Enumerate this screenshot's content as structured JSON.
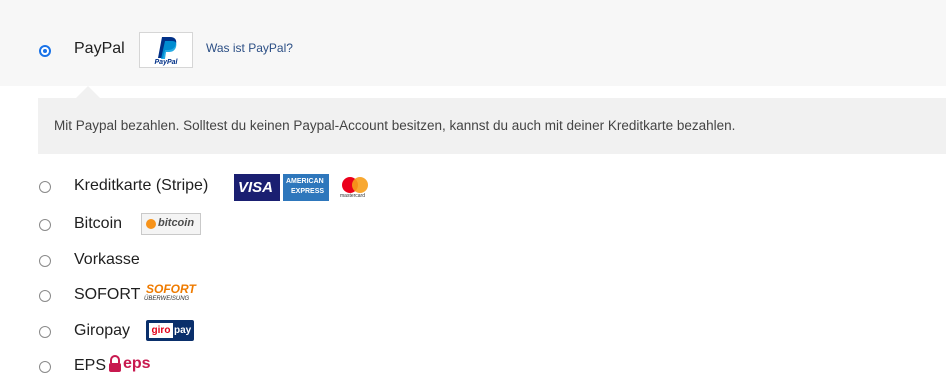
{
  "payment_methods": [
    {
      "label": "PayPal",
      "selected": true
    },
    {
      "label": "Kreditkarte (Stripe)",
      "selected": false
    },
    {
      "label": "Bitcoin",
      "selected": false
    },
    {
      "label": "Vorkasse",
      "selected": false
    },
    {
      "label": "SOFORT",
      "selected": false
    },
    {
      "label": "Giropay",
      "selected": false
    },
    {
      "label": "EPS",
      "selected": false
    }
  ],
  "paypal": {
    "what_is_link": "Was ist PayPal?",
    "description": "Mit Paypal bezahlen. Solltest du keinen Paypal-Account besitzen, kannst du auch mit deiner Kreditkarte bezahlen.",
    "logo_text": "PayPal"
  },
  "logos": {
    "visa": "VISA",
    "amex_line1": "AMERICAN",
    "amex_line2": "EXPRESS",
    "mastercard": "mastercard",
    "bitcoin": "bitcoin",
    "sofort": "SOFORT",
    "sofort_sub": "ÜBERWEISUNG",
    "giro": "giro",
    "pay": "pay",
    "eps": "eps"
  },
  "colors": {
    "accent": "#1a73e8",
    "visa_blue": "#1a1f71",
    "amex_blue": "#2e77bc",
    "mastercard_red": "#eb001b",
    "mastercard_orange": "#f79e1b",
    "sofort_orange": "#ef7b00",
    "giro_red": "#e2001a",
    "giro_blue": "#0a2f6b",
    "eps_pink": "#c8194f"
  }
}
